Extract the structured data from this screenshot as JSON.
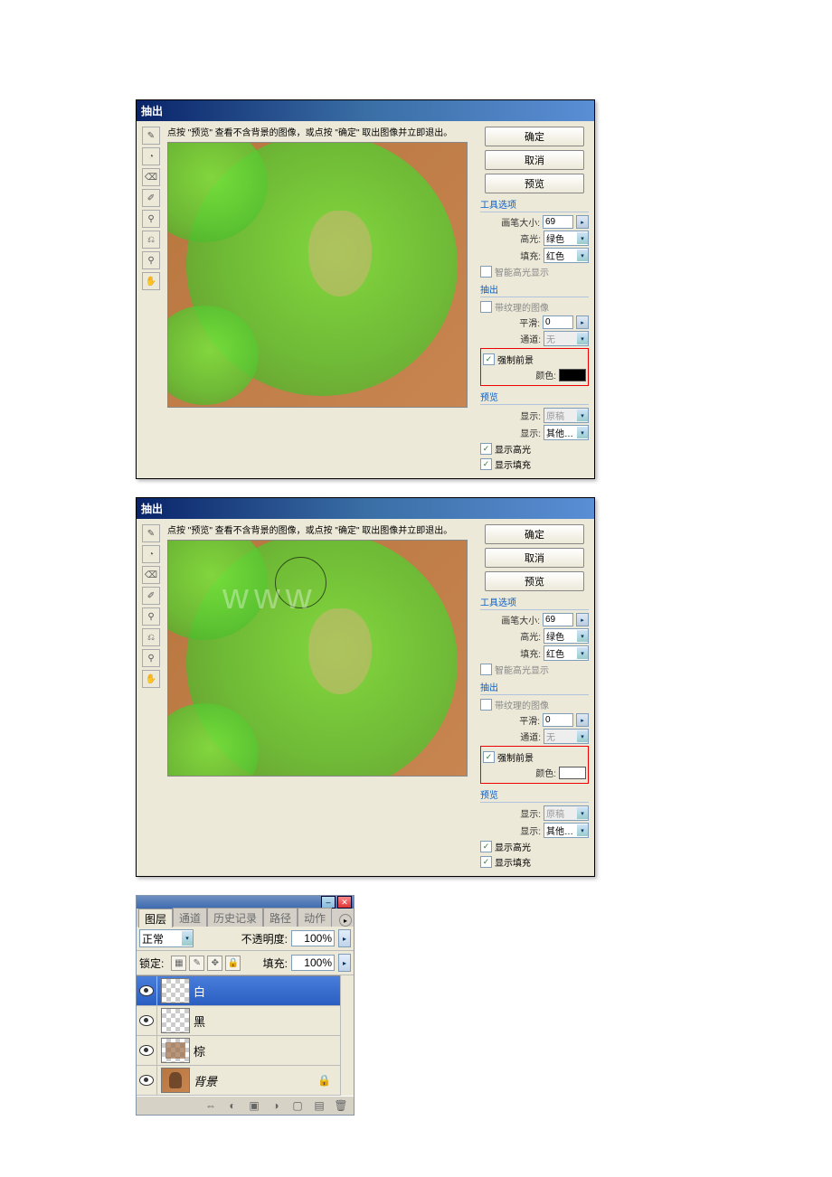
{
  "dialog1": {
    "title": "抽出",
    "instruction": "点按 \"预览\" 查看不含背景的图像，或点按 \"确定\" 取出图像并立即退出。",
    "buttons": {
      "ok": "确定",
      "cancel": "取消",
      "preview": "预览"
    },
    "tool_options": {
      "section": "工具选项",
      "brush_label": "画笔大小:",
      "brush_value": "69",
      "highlight_label": "高光:",
      "highlight_value": "绿色",
      "fill_label": "填充:",
      "fill_value": "红色",
      "smart_label": "智能高光显示"
    },
    "extract": {
      "section": "抽出",
      "textured_label": "带纹理的图像",
      "smooth_label": "平滑:",
      "smooth_value": "0",
      "channel_label": "通道:",
      "channel_value": "无",
      "force_fg_label": "强制前景",
      "color_label": "颜色:"
    },
    "preview_sec": {
      "section": "预览",
      "show_label": "显示:",
      "show_value": "原稿",
      "display_label": "显示:",
      "display_value": "其他…",
      "show_highlight": "显示高光",
      "show_fill": "显示填充"
    }
  },
  "dialog2": {
    "title": "抽出",
    "instruction": "点按 \"预览\" 查看不含背景的图像，或点按 \"确定\" 取出图像并立即退出。",
    "buttons": {
      "ok": "确定",
      "cancel": "取消",
      "preview": "预览"
    },
    "tool_options": {
      "section": "工具选项",
      "brush_label": "画笔大小:",
      "brush_value": "69",
      "highlight_label": "高光:",
      "highlight_value": "绿色",
      "fill_label": "填充:",
      "fill_value": "红色",
      "smart_label": "智能高光显示"
    },
    "extract": {
      "section": "抽出",
      "textured_label": "带纹理的图像",
      "smooth_label": "平滑:",
      "smooth_value": "0",
      "channel_label": "通道:",
      "channel_value": "无",
      "force_fg_label": "强制前景",
      "color_label": "颜色:"
    },
    "preview_sec": {
      "section": "预览",
      "show_label": "显示:",
      "show_value": "原稿",
      "display_label": "显示:",
      "display_value": "其他…",
      "show_highlight": "显示高光",
      "show_fill": "显示填充"
    }
  },
  "layers": {
    "tabs": [
      "图层",
      "通道",
      "历史记录",
      "路径",
      "动作"
    ],
    "blend_label": "正常",
    "opacity_label": "不透明度:",
    "opacity_value": "100%",
    "lock_label": "锁定:",
    "fill_label": "填充:",
    "fill_value": "100%",
    "items": [
      {
        "name": "白",
        "locked": false
      },
      {
        "name": "黑",
        "locked": false
      },
      {
        "name": "棕",
        "locked": false
      },
      {
        "name": "背景",
        "locked": true
      }
    ]
  },
  "misc": {
    "watermark": "www"
  }
}
